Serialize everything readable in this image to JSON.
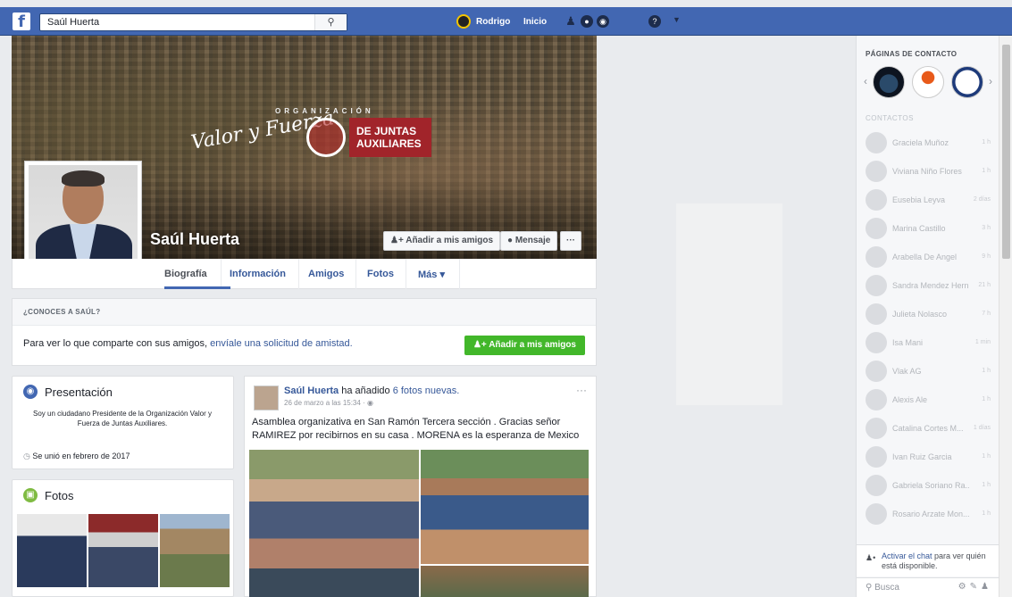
{
  "topbar": {
    "logo": "f",
    "search_value": "Saúl Huerta",
    "search_icon": "search-icon",
    "user_name": "Rodrigo",
    "home_label": "Inicio",
    "icons": [
      "friends-icon",
      "messages-icon",
      "notifications-icon",
      "help-icon",
      "caret-down-icon"
    ]
  },
  "cover": {
    "banner_org": "ORGANIZACIÓN",
    "banner_main": "Valor y Fuerza",
    "banner_sub1": "DE JUNTAS",
    "banner_sub2": "AUXILIARES",
    "profile_name": "Saúl Huerta",
    "add_friend_label": "Añadir a mis amigos",
    "message_label": "Mensaje",
    "more_label": "···"
  },
  "tabs": [
    {
      "label": "Biografía"
    },
    {
      "label": "Información"
    },
    {
      "label": "Amigos"
    },
    {
      "label": "Fotos"
    },
    {
      "label": "Más ▾"
    }
  ],
  "know": {
    "heading": "¿CONOCES A SAÚL?",
    "text": "Para ver lo que comparte con sus amigos, ",
    "link": "envíale una solicitud de amistad.",
    "button": "Añadir a mis amigos"
  },
  "intro": {
    "title": "Presentación",
    "text": "Soy un ciudadano Presidente de la Organización Valor y Fuerza de Juntas Auxiliares.",
    "joined": "Se unió en febrero de 2017"
  },
  "photos": {
    "title": "Fotos"
  },
  "post": {
    "author": "Saúl Huerta",
    "action": " ha añadido ",
    "action_link": "6 fotos nuevas.",
    "time": "26 de marzo a las 15:34 · ",
    "more": "···",
    "text": "Asamblea organizativa en San Ramón Tercera sección . Gracias señor RAMIREZ por recibirnos en su casa . MORENA es la esperanza de Mexico"
  },
  "sidebar": {
    "pages_title": "PÁGINAS DE CONTACTO",
    "contacts_title": "CONTACTOS",
    "contacts": [
      {
        "name": "Graciela Muñoz",
        "time": "1 h"
      },
      {
        "name": "Viviana Niño Flores",
        "time": "1 h"
      },
      {
        "name": "Eusebia Leyva",
        "time": "2 días"
      },
      {
        "name": "Marina Castillo",
        "time": "3 h"
      },
      {
        "name": "Arabella De Angel",
        "time": "9 h"
      },
      {
        "name": "Sandra Mendez Hern...",
        "time": "21 h"
      },
      {
        "name": "Julieta Nolasco",
        "time": "7 h"
      },
      {
        "name": "Isa Mani",
        "time": "1 min"
      },
      {
        "name": "Vlak AG",
        "time": "1 h"
      },
      {
        "name": "Alexis Ale",
        "time": "1 h"
      },
      {
        "name": "Catalina Cortes M...",
        "time": "1 días"
      },
      {
        "name": "Ivan Ruiz Garcia",
        "time": "1 h"
      },
      {
        "name": "Gabriela Soriano Ra...",
        "time": "1 h"
      },
      {
        "name": "Rosario Arzate Mon...",
        "time": "1 h"
      }
    ],
    "chat_link": "Activar el chat",
    "chat_text": " para ver quién está disponible.",
    "search_placeholder": "Busca"
  }
}
